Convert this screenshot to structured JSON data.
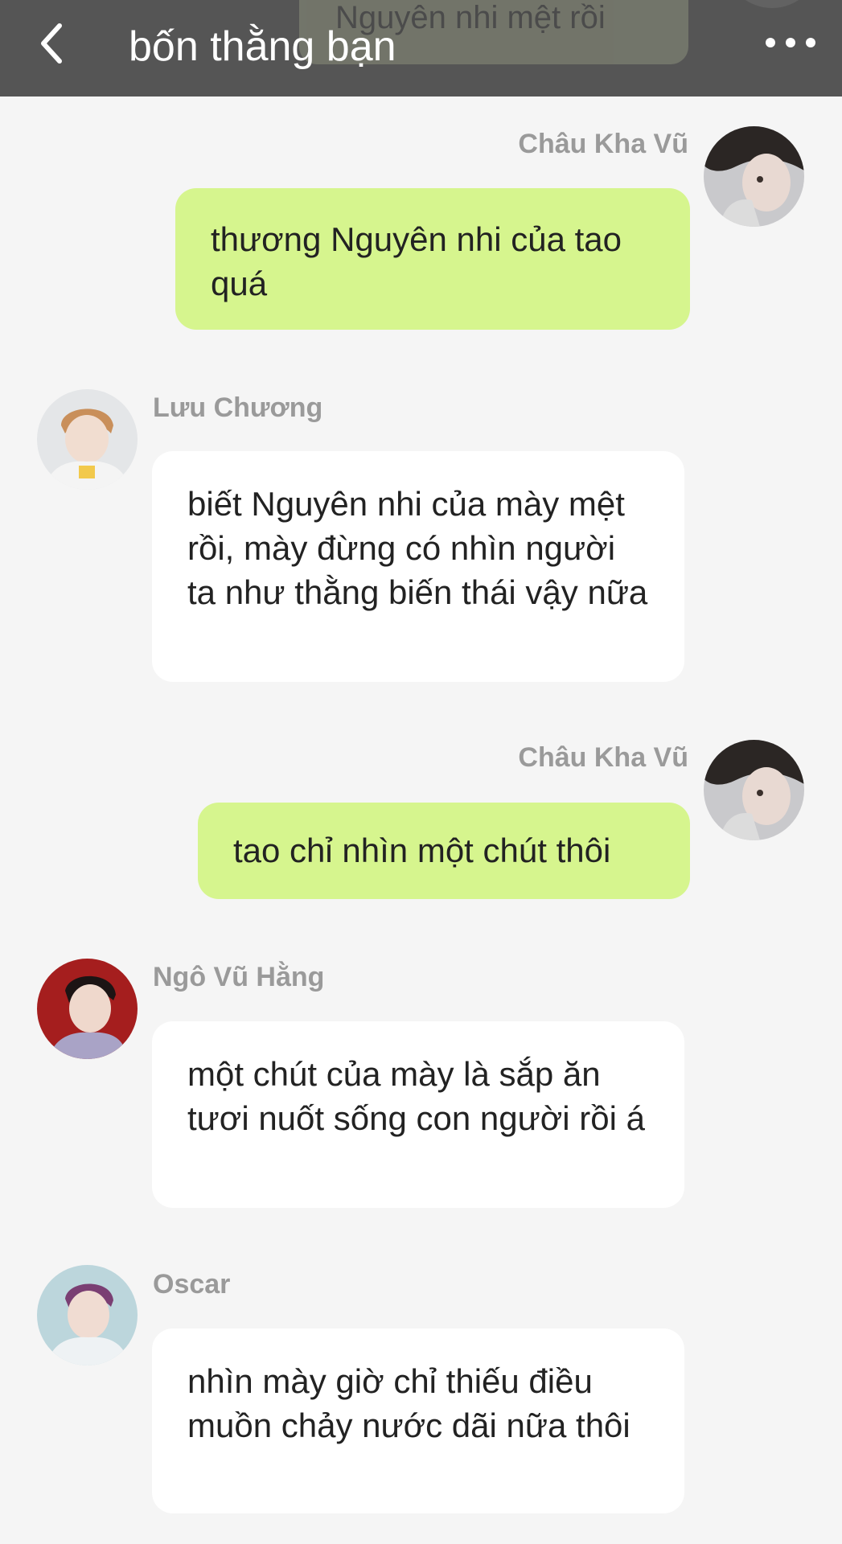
{
  "header": {
    "title": "bốn thằng bạn",
    "previous_message_peek": "Nguyên nhi mệt rồi",
    "back_icon": "chevron-left-icon",
    "more_icon": "more-horizontal-icon"
  },
  "messages": [
    {
      "sender": "Châu Kha Vũ",
      "side": "right",
      "text": "thương Nguyên nhi của tao quá"
    },
    {
      "sender": "Lưu Chương",
      "side": "left",
      "text": "biết Nguyên nhi của mày mệt rồi, mày đừng có nhìn người ta như thằng biến thái vậy nữa"
    },
    {
      "sender": "Châu Kha Vũ",
      "side": "right",
      "text": "tao chỉ nhìn một chút thôi"
    },
    {
      "sender": "Ngô Vũ Hằng",
      "side": "left",
      "text": "một chút của mày là sắp ăn tươi nuốt sống con người rồi á"
    },
    {
      "sender": "Oscar",
      "side": "left",
      "text": "nhìn mày giờ chỉ thiếu điều muồn chảy nước dãi nữa thôi"
    }
  ],
  "colors": {
    "header_bg": "#555555",
    "page_bg": "#f5f5f5",
    "my_bubble": "#d6f58e",
    "their_bubble": "#ffffff",
    "sender_name": "#9a9a9a"
  }
}
